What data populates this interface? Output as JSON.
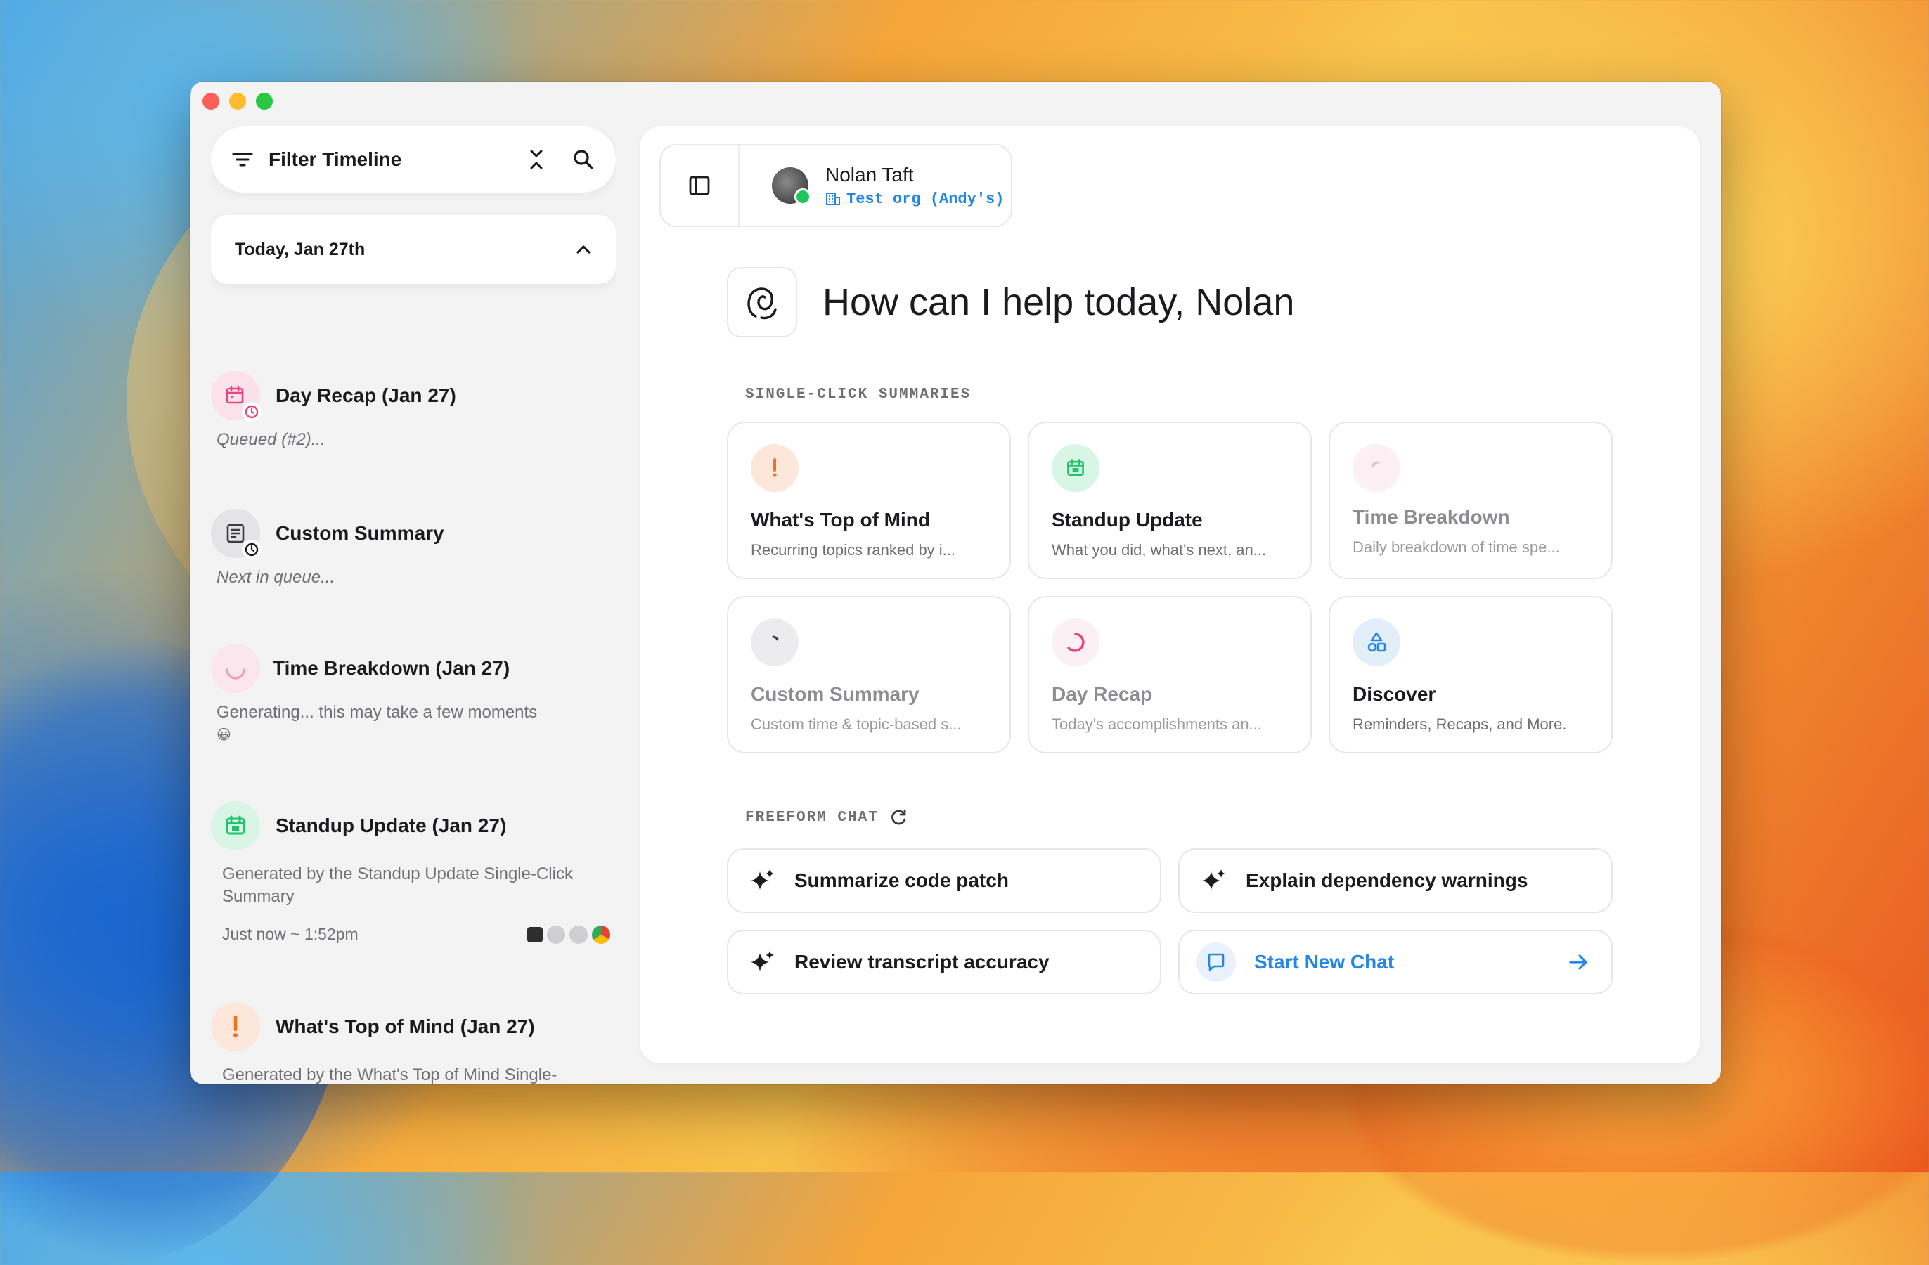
{
  "sidebar": {
    "filter_label": "Filter Timeline",
    "date_label": "Today, Jan 27th",
    "items": [
      {
        "title": "Day Recap (Jan 27)",
        "sub": "Queued (#2)..."
      },
      {
        "title": "Custom Summary",
        "sub": "Next in queue..."
      },
      {
        "title": "Time Breakdown (Jan 27)",
        "sub": "Generating... this may take a few moments",
        "emoji": "😀"
      },
      {
        "title": "Standup Update (Jan 27)",
        "sub": "Generated by the Standup Update Single-Click Summary",
        "time": "Just now ~ 1:52pm"
      },
      {
        "title": "What's Top of Mind (Jan 27)",
        "sub": "Generated by the What's Top of Mind Single-Click Summary"
      }
    ]
  },
  "user": {
    "name": "Nolan Taft",
    "org": "Test org (Andy's)"
  },
  "greeting": "How can I help today, Nolan",
  "summaries": {
    "label": "SINGLE-CLICK SUMMARIES",
    "cards": [
      {
        "title": "What's Top of Mind",
        "sub": "Recurring topics ranked by i..."
      },
      {
        "title": "Standup Update",
        "sub": "What you did, what's next, an..."
      },
      {
        "title": "Time Breakdown",
        "sub": "Daily breakdown of time spe..."
      },
      {
        "title": "Custom Summary",
        "sub": "Custom time & topic-based s..."
      },
      {
        "title": "Day Recap",
        "sub": "Today's accomplishments an..."
      },
      {
        "title": "Discover",
        "sub": "Reminders, Recaps, and More."
      }
    ]
  },
  "freeform": {
    "label": "FREEFORM CHAT",
    "prompts": [
      "Summarize code patch",
      "Explain dependency warnings",
      "Review transcript accuracy"
    ],
    "new_chat": "Start New Chat"
  },
  "colors": {
    "accent_blue": "#2486e6",
    "pink": "#e8457a",
    "green": "#1fc46a",
    "orange": "#f2711c"
  },
  "icons": [
    "filter-icon",
    "collapse-icon",
    "search-icon",
    "chevron-up-icon",
    "sidebar-toggle-icon",
    "building-icon",
    "sparkle-icon",
    "chat-icon",
    "arrow-right-icon",
    "refresh-icon"
  ]
}
